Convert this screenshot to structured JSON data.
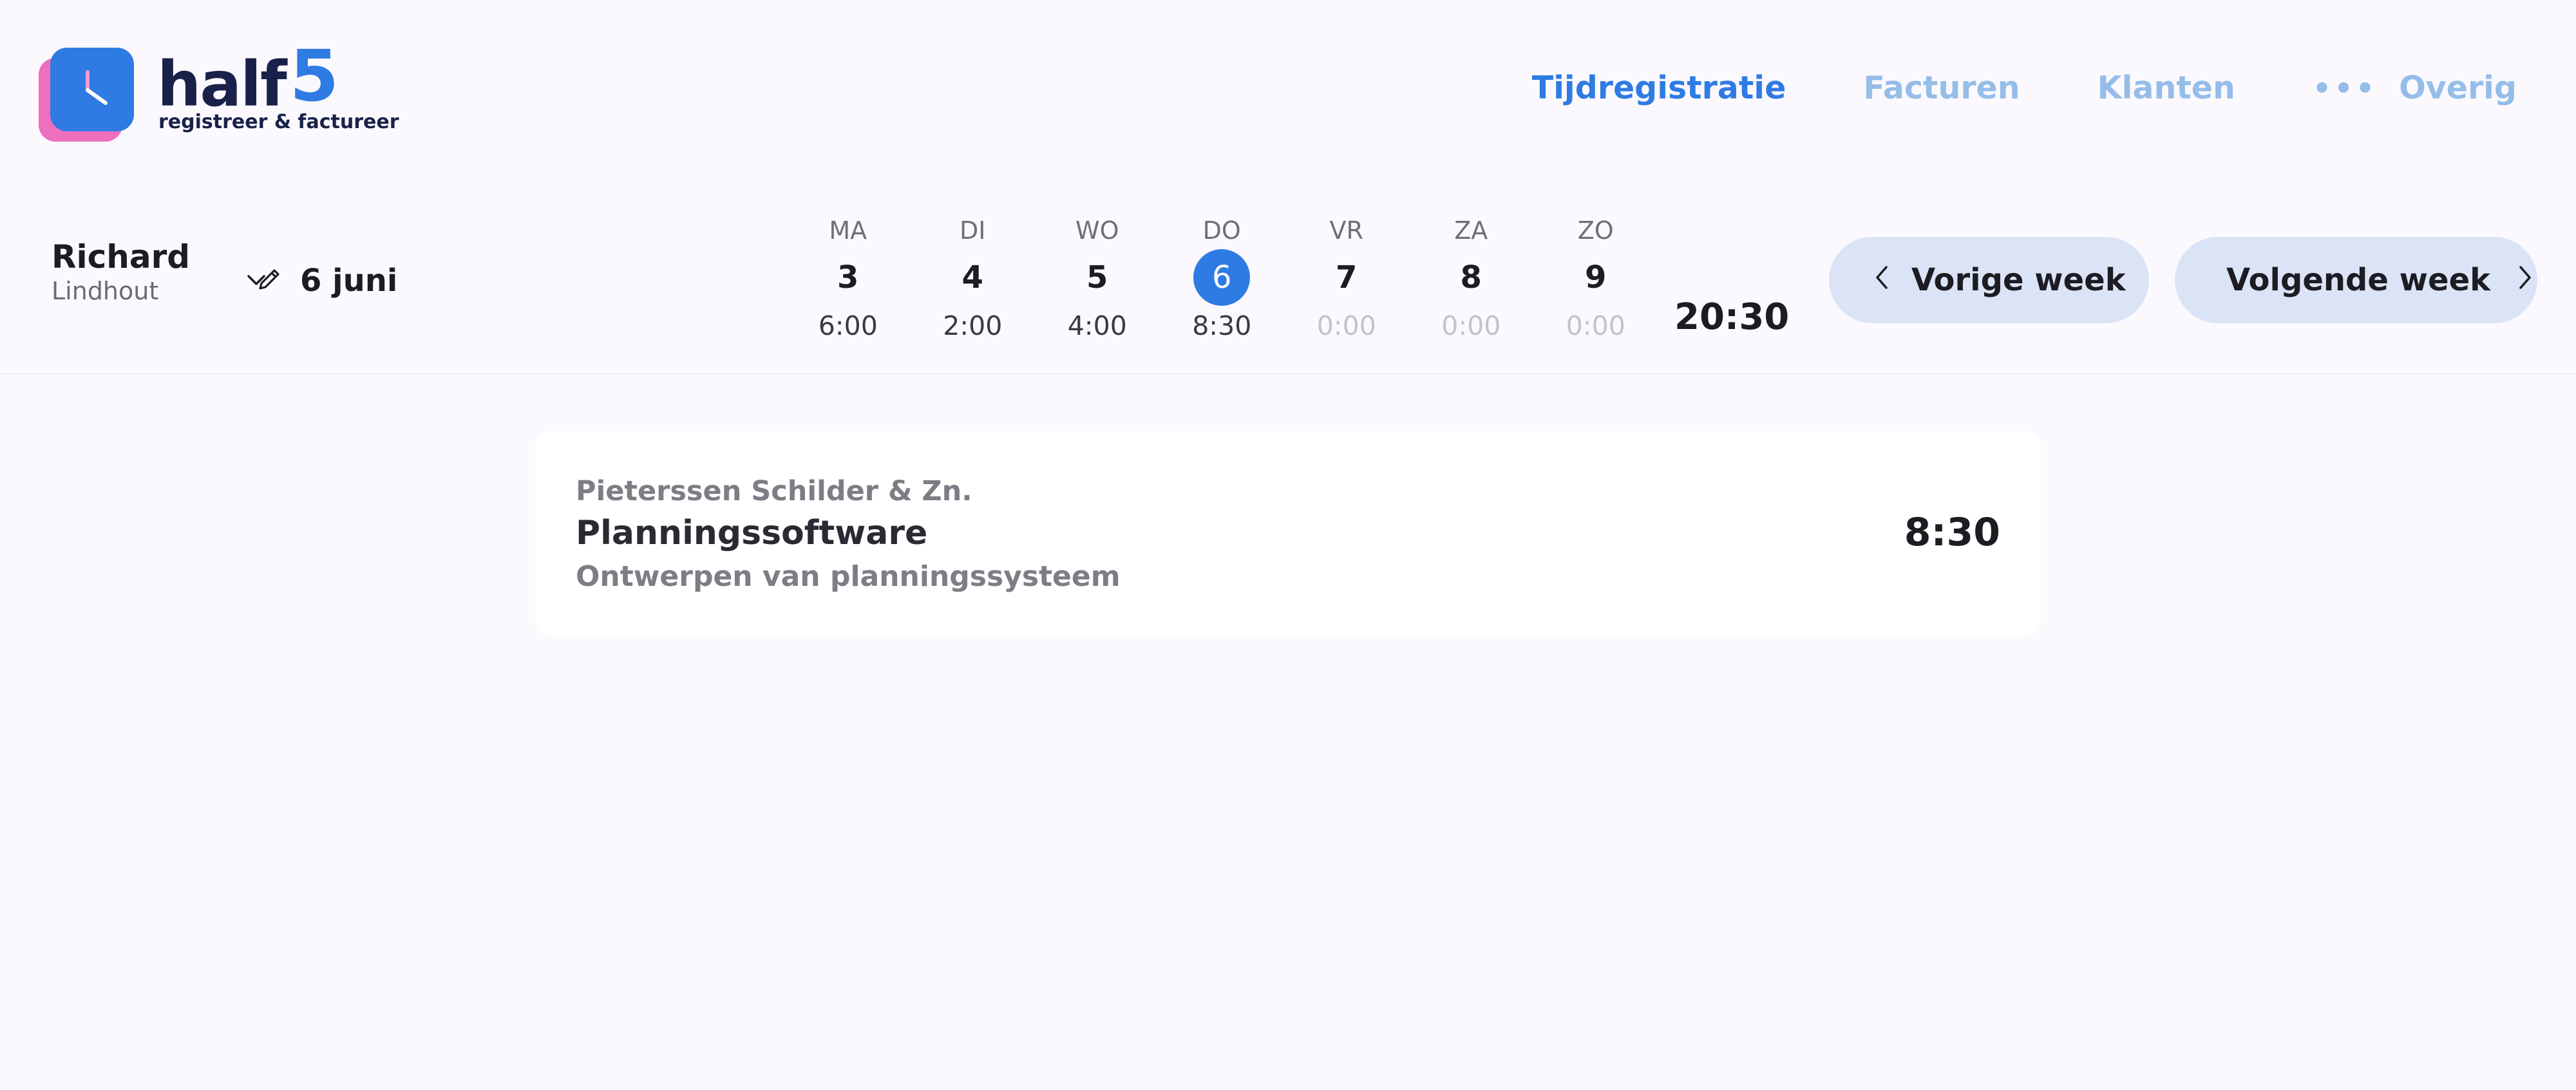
{
  "brand": {
    "name_part1": "half",
    "name_part2": "5",
    "tagline": "registreer & factureer"
  },
  "nav": {
    "items": [
      {
        "label": "Tijdregistratie",
        "active": true
      },
      {
        "label": "Facturen",
        "active": false
      },
      {
        "label": "Klanten",
        "active": false
      }
    ],
    "more": {
      "icon": "more-dots-icon",
      "label": "Overig"
    }
  },
  "user": {
    "first_name": "Richard",
    "last_name": "Lindhout"
  },
  "date_picker": {
    "label": "6 juni",
    "icon": "pencil-icon"
  },
  "week": {
    "days": [
      {
        "abbr": "MA",
        "num": "3",
        "hours": "6:00",
        "selected": false,
        "empty": false
      },
      {
        "abbr": "DI",
        "num": "4",
        "hours": "2:00",
        "selected": false,
        "empty": false
      },
      {
        "abbr": "WO",
        "num": "5",
        "hours": "4:00",
        "selected": false,
        "empty": false
      },
      {
        "abbr": "DO",
        "num": "6",
        "hours": "8:30",
        "selected": true,
        "empty": false
      },
      {
        "abbr": "VR",
        "num": "7",
        "hours": "0:00",
        "selected": false,
        "empty": true
      },
      {
        "abbr": "ZA",
        "num": "8",
        "hours": "0:00",
        "selected": false,
        "empty": true
      },
      {
        "abbr": "ZO",
        "num": "9",
        "hours": "0:00",
        "selected": false,
        "empty": true
      }
    ],
    "total": "20:30",
    "prev_label": "Vorige week",
    "next_label": "Volgende week"
  },
  "entries": [
    {
      "client": "Pieterssen Schilder & Zn.",
      "project": "Planningssoftware",
      "task": "Ontwerpen van planningssysteem",
      "duration": "8:30"
    }
  ],
  "colors": {
    "accent": "#2f7be4",
    "accent_light": "#95bde9",
    "logo_pink": "#ef6fbf",
    "brand_dark": "#19214a",
    "button_bg": "#dbe4f6",
    "page_bg": "#fbf9fd"
  }
}
